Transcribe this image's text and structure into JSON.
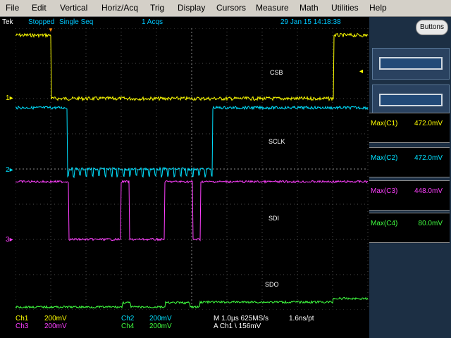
{
  "menu": [
    "File",
    "Edit",
    "Vertical",
    "Horiz/Acq",
    "Trig",
    "Display",
    "Cursors",
    "Measure",
    "Math",
    "Utilities",
    "Help"
  ],
  "status": {
    "brand": "Tek",
    "state": "Stopped",
    "mode": "Single Seq",
    "acqs": "1 Acqs",
    "timestamp": "29 Jan 15 14:18:38"
  },
  "buttons_label": "Buttons",
  "channel_markers": [
    "1",
    "2",
    "3"
  ],
  "signal_labels": {
    "csb": "CSB",
    "sclk": "SCLK",
    "sdi": "SDI",
    "sdo": "SDO"
  },
  "measurements": [
    {
      "label": "Max(C1)",
      "value": "472.0mV",
      "color": "#ffff00"
    },
    {
      "label": "Max(C2)",
      "value": "472.0mV",
      "color": "#00e0ff"
    },
    {
      "label": "Max(C3)",
      "value": "448.0mV",
      "color": "#ff40ff"
    },
    {
      "label": "Max(C4)",
      "value": "80.0mV",
      "color": "#40ff40"
    }
  ],
  "footer": {
    "ch1_label": "Ch1",
    "ch1_scale": "200mV",
    "ch2_label": "Ch2",
    "ch2_scale": "200mV",
    "ch3_label": "Ch3",
    "ch3_scale": "200mV",
    "ch4_label": "Ch4",
    "ch4_scale": "200mV",
    "timebase": "M 1.0µs 625MS/s",
    "resolution": "1.6ns/pt",
    "trigger": "A Ch1 \\ 156mV"
  },
  "colors": {
    "ch1": "#ffff00",
    "ch2": "#00e0ff",
    "ch3": "#ff40ff",
    "ch4": "#40ff40",
    "status": "#00c8ff"
  }
}
